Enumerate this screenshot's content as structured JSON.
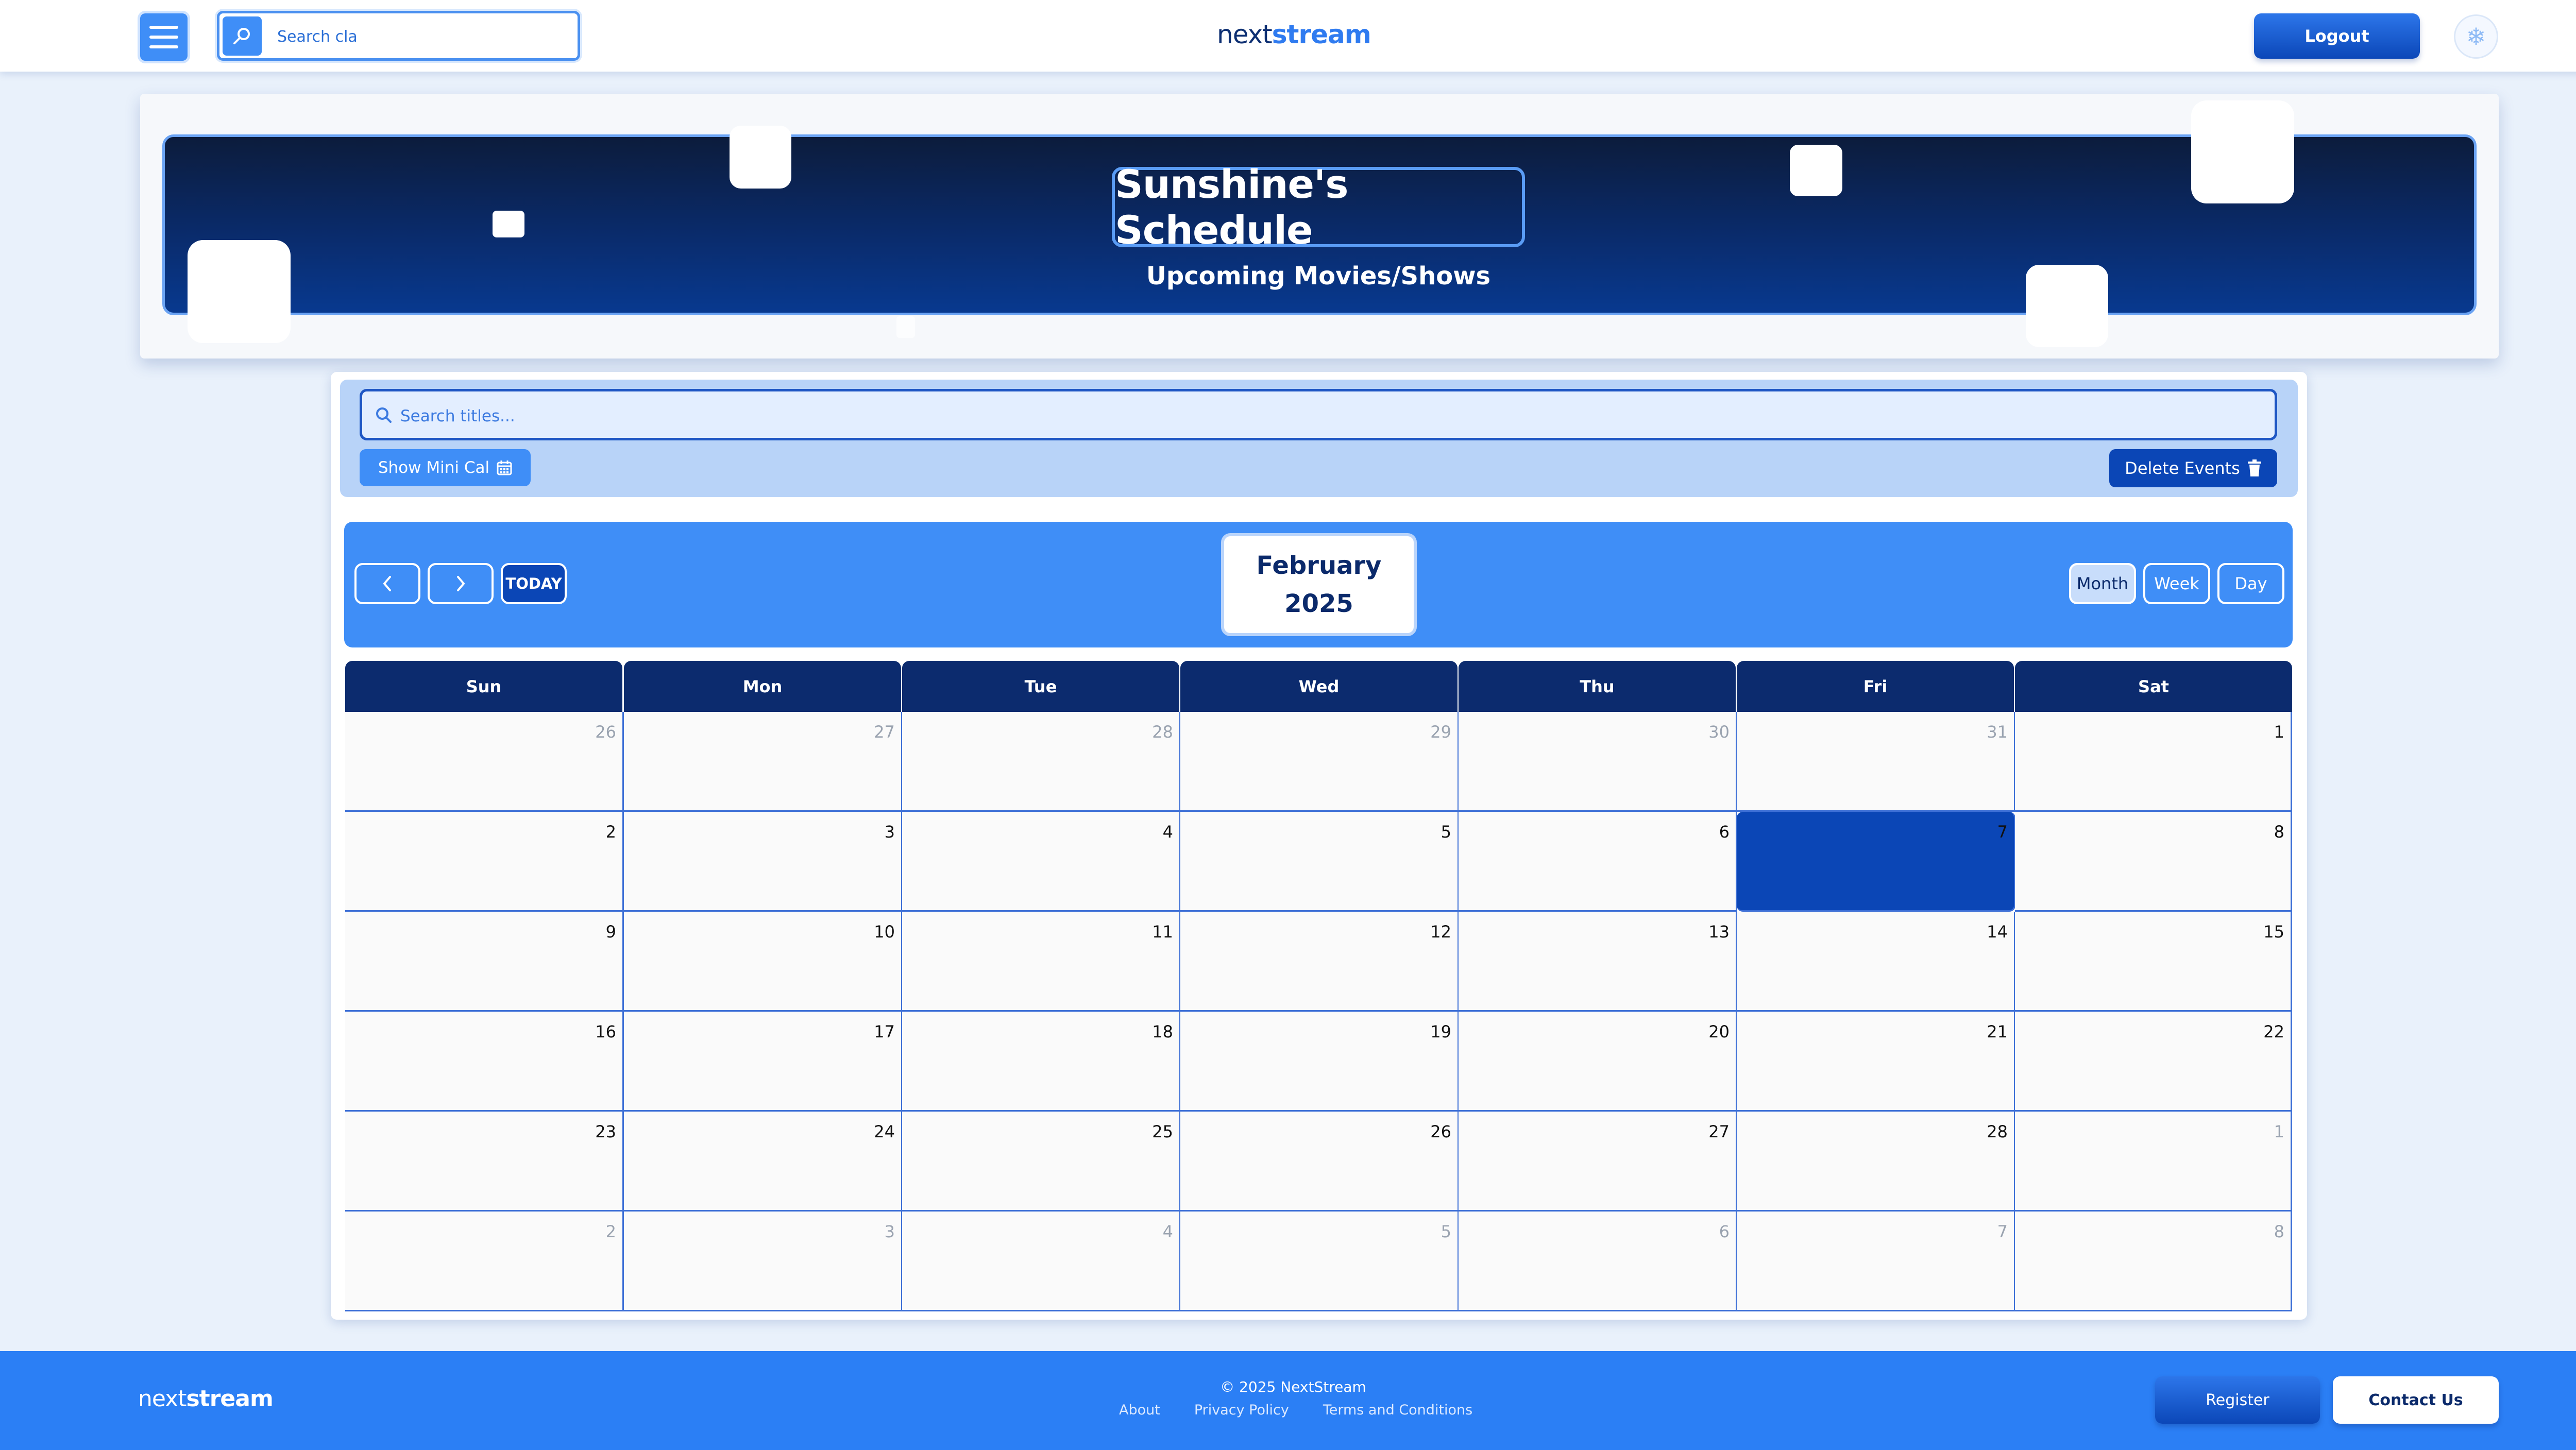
{
  "header": {
    "search_text": "Search cla",
    "brand_part1": "next",
    "brand_part2": "stream",
    "logout_label": "Logout",
    "theme_icon": "snowflake-icon"
  },
  "hero": {
    "title": "Sunshine's Schedule",
    "subtitle": "Upcoming Movies/Shows"
  },
  "toolbar": {
    "search_placeholder": "Search titles...",
    "mini_cal_label": "Show Mini Cal",
    "delete_label": "Delete Events"
  },
  "calendar_nav": {
    "today_label": "TODAY",
    "month": "February",
    "year": "2025",
    "views": [
      "Month",
      "Week",
      "Day"
    ],
    "active_view": "Month"
  },
  "calendar": {
    "weekdays": [
      "Sun",
      "Mon",
      "Tue",
      "Wed",
      "Thu",
      "Fri",
      "Sat"
    ],
    "weeks": [
      [
        {
          "d": "26",
          "other": true
        },
        {
          "d": "27",
          "other": true
        },
        {
          "d": "28",
          "other": true
        },
        {
          "d": "29",
          "other": true
        },
        {
          "d": "30",
          "other": true
        },
        {
          "d": "31",
          "other": true
        },
        {
          "d": "1",
          "other": false
        }
      ],
      [
        {
          "d": "2",
          "other": false
        },
        {
          "d": "3",
          "other": false
        },
        {
          "d": "4",
          "other": false
        },
        {
          "d": "5",
          "other": false
        },
        {
          "d": "6",
          "other": false
        },
        {
          "d": "7",
          "other": false,
          "today": true
        },
        {
          "d": "8",
          "other": false
        }
      ],
      [
        {
          "d": "9",
          "other": false
        },
        {
          "d": "10",
          "other": false
        },
        {
          "d": "11",
          "other": false
        },
        {
          "d": "12",
          "other": false
        },
        {
          "d": "13",
          "other": false
        },
        {
          "d": "14",
          "other": false
        },
        {
          "d": "15",
          "other": false
        }
      ],
      [
        {
          "d": "16",
          "other": false
        },
        {
          "d": "17",
          "other": false
        },
        {
          "d": "18",
          "other": false
        },
        {
          "d": "19",
          "other": false
        },
        {
          "d": "20",
          "other": false
        },
        {
          "d": "21",
          "other": false
        },
        {
          "d": "22",
          "other": false
        }
      ],
      [
        {
          "d": "23",
          "other": false
        },
        {
          "d": "24",
          "other": false
        },
        {
          "d": "25",
          "other": false
        },
        {
          "d": "26",
          "other": false
        },
        {
          "d": "27",
          "other": false
        },
        {
          "d": "28",
          "other": false
        },
        {
          "d": "1",
          "other": true
        }
      ],
      [
        {
          "d": "2",
          "other": true
        },
        {
          "d": "3",
          "other": true
        },
        {
          "d": "4",
          "other": true
        },
        {
          "d": "5",
          "other": true
        },
        {
          "d": "6",
          "other": true
        },
        {
          "d": "7",
          "other": true
        },
        {
          "d": "8",
          "other": true
        }
      ]
    ]
  },
  "footer": {
    "brand_part1": "next",
    "brand_part2": "stream",
    "copyright": "© 2025 NextStream",
    "links": [
      "About",
      "Privacy Policy",
      "Terms and Conditions"
    ],
    "register_label": "Register",
    "contact_label": "Contact Us"
  },
  "colors": {
    "page_bg": "#e9f1fb",
    "accent": "#3f8ef7",
    "dark_blue": "#0b46b6",
    "navy": "#0c2b6e",
    "footer": "#2b7ff5"
  }
}
